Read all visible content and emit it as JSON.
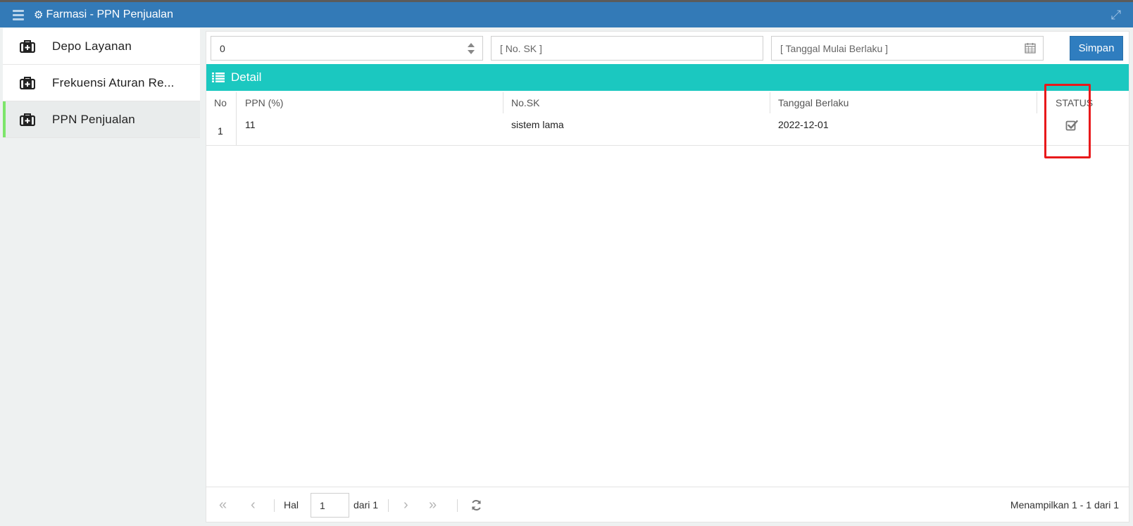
{
  "app": {
    "title": "Farmasi - PPN Penjualan",
    "accent": "#337ab7",
    "detail_color": "#1bc8c0",
    "active_marker": "#7de56b",
    "highlight_border": "#e8191b"
  },
  "sidebar": {
    "items": [
      {
        "label": "Depo Layanan",
        "icon": "medical-kit-icon",
        "active": false
      },
      {
        "label": "Frekuensi Aturan Re...",
        "icon": "medical-kit-icon",
        "active": false
      },
      {
        "label": "PPN Penjualan",
        "icon": "medical-kit-icon",
        "active": true
      }
    ]
  },
  "form": {
    "ppn_value": "0",
    "no_sk_placeholder": "[ No. SK ]",
    "tanggal_placeholder": "[ Tanggal Mulai Berlaku ]",
    "save_label": "Simpan"
  },
  "detail": {
    "title": "Detail",
    "columns": [
      "No",
      "PPN (%)",
      "No.SK",
      "Tanggal Berlaku",
      "STATUS"
    ],
    "rows": [
      {
        "no": "1",
        "ppn": "11",
        "no_sk": "sistem lama",
        "tanggal": "2022-12-01",
        "status_checked": true
      }
    ]
  },
  "pagination": {
    "hal_label": "Hal",
    "page": "1",
    "dari_label": "dari 1",
    "summary": "Menampilkan 1 - 1 dari 1"
  }
}
